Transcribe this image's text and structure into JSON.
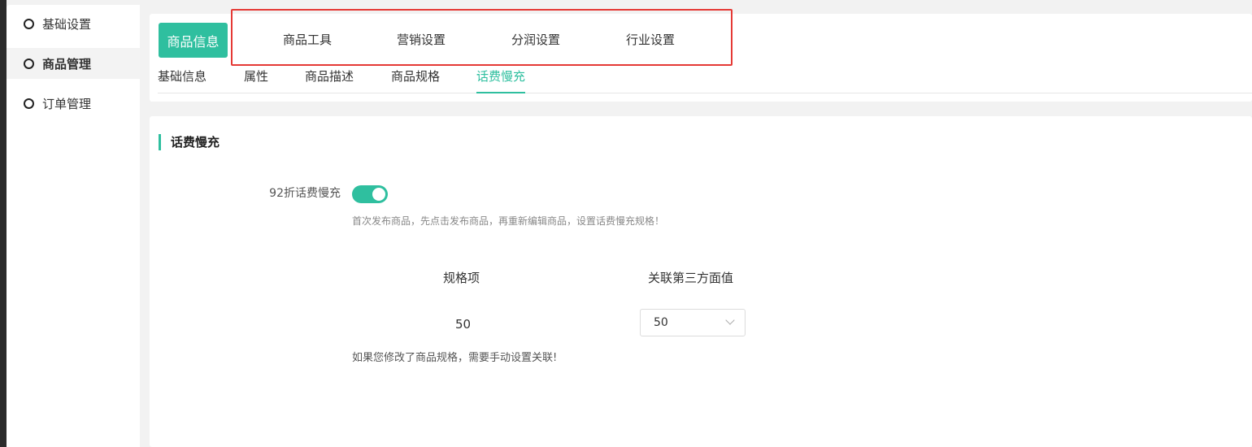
{
  "sidebar": {
    "items": [
      {
        "label": "基础设置",
        "active": false
      },
      {
        "label": "商品管理",
        "active": true
      },
      {
        "label": "订单管理",
        "active": false
      }
    ]
  },
  "main_tabs": {
    "active_label": "商品信息",
    "items": [
      "商品工具",
      "营销设置",
      "分润设置",
      "行业设置"
    ]
  },
  "sub_tabs": {
    "items": [
      "基础信息",
      "属性",
      "商品描述",
      "商品规格",
      "话费慢充"
    ],
    "active": "话费慢充"
  },
  "section": {
    "title": "话费慢充",
    "toggle_label": "92折话费慢充",
    "toggle_on": true,
    "hint_publish": "首次发布商品，先点击发布商品，再重新编辑商品，设置话费慢充规格！",
    "table": {
      "headers": [
        "规格项",
        "关联第三方面值"
      ],
      "rows": [
        {
          "spec": "50",
          "value": "50"
        }
      ]
    },
    "hint_modify": "如果您修改了商品规格，需要手动设置关联!"
  },
  "colors": {
    "accent": "#2fbf9f",
    "highlight_border": "#e53935"
  },
  "icons": {
    "sidebar_bullet": "circle-icon",
    "select_arrow": "chevron-down-icon"
  }
}
